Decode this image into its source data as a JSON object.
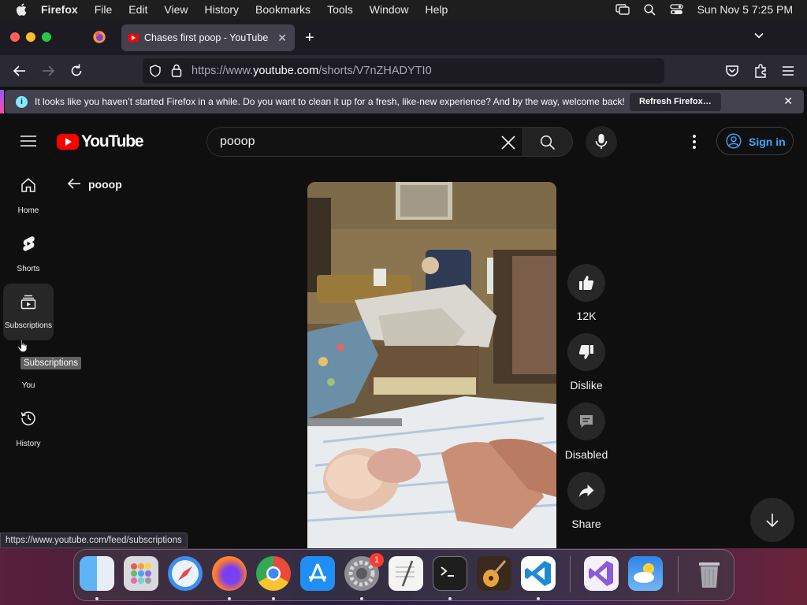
{
  "menubar": {
    "app": "Firefox",
    "items": [
      "File",
      "Edit",
      "View",
      "History",
      "Bookmarks",
      "Tools",
      "Window",
      "Help"
    ],
    "clock": "Sun Nov 5  7:25 PM"
  },
  "browser": {
    "tab_title": "Chases first poop - YouTube",
    "url_prefix": "https://www.",
    "url_domain": "youtube.com",
    "url_path": "/shorts/V7nZHADYTI0",
    "notification": "It looks like you haven’t started Firefox in a while. Do you want to clean it up for a fresh, like-new experience? And by the way, welcome back!",
    "refresh_label": "Refresh Firefox…",
    "status_url": "https://www.youtube.com/feed/subscriptions"
  },
  "youtube": {
    "logo_text": "YouTube",
    "search_value": "pooop",
    "sign_in": "Sign in",
    "guide": {
      "home": "Home",
      "shorts": "Shorts",
      "subscriptions": "Subscriptions",
      "you": "You",
      "history": "History"
    },
    "tooltip": "Subscriptions",
    "query_title": "pooop",
    "actions": {
      "like_count": "12K",
      "dislike": "Dislike",
      "comments": "Disabled",
      "share": "Share"
    }
  },
  "dock": {
    "apps": [
      "Finder",
      "Launchpad",
      "Safari",
      "Firefox",
      "Chrome",
      "App Store",
      "System Settings",
      "TextEdit",
      "Terminal",
      "GarageBand",
      "VS Code",
      "Visual Studio",
      "Weather",
      "Trash"
    ],
    "settings_badge": "1"
  },
  "colors": {
    "youtube_red": "#ff0000",
    "link_blue": "#3ea6ff",
    "page_bg": "#0f0f0f"
  }
}
